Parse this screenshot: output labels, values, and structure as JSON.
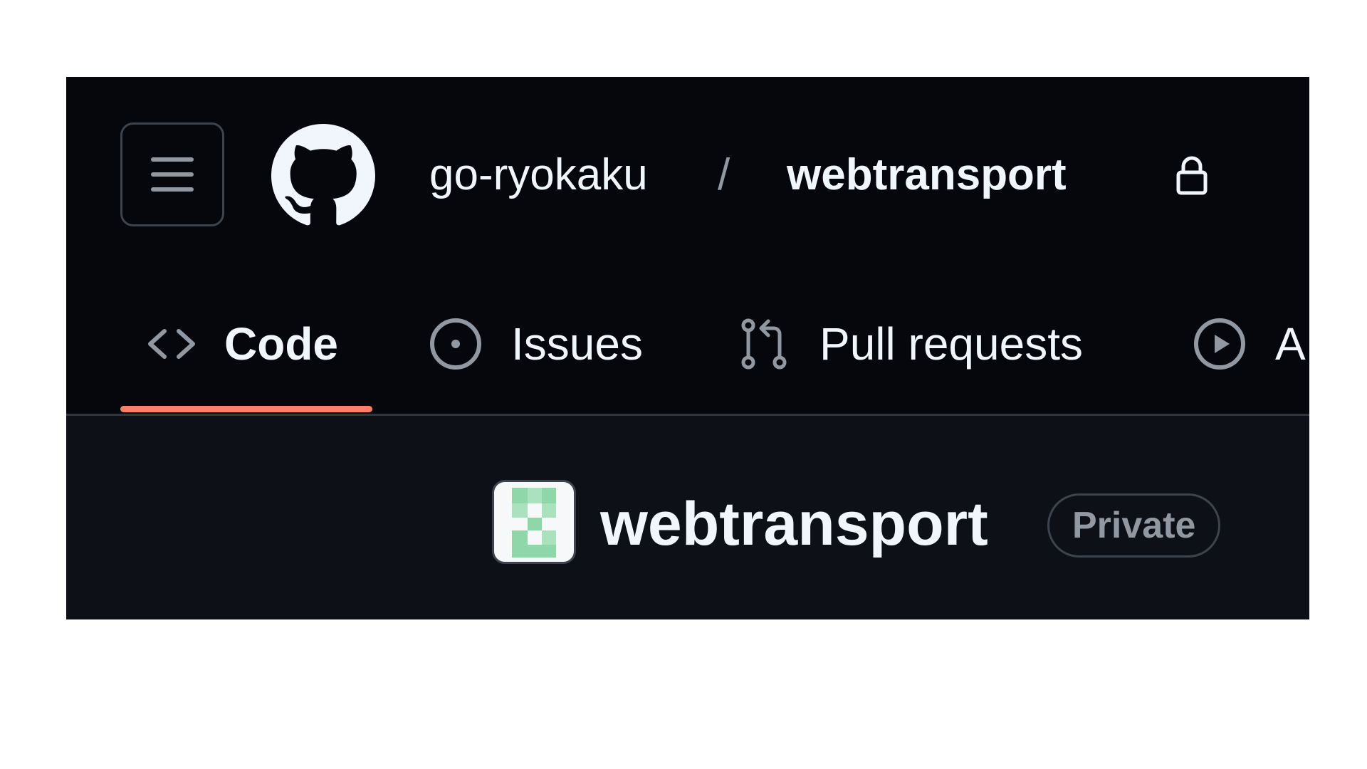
{
  "header": {
    "owner": "go-ryokaku",
    "separator": "/",
    "repo": "webtransport",
    "menu_icon": "hamburger-icon",
    "logo_icon": "github-mark-icon",
    "lock_icon": "lock-icon"
  },
  "tabs": [
    {
      "label": "Code",
      "icon": "code-icon",
      "selected": true
    },
    {
      "label": "Issues",
      "icon": "issue-opened-icon",
      "selected": false
    },
    {
      "label": "Pull requests",
      "icon": "git-pull-request-icon",
      "selected": false
    },
    {
      "label": "A",
      "icon": "play-icon",
      "selected": false
    }
  ],
  "repo_title": {
    "name": "webtransport",
    "visibility": "Private",
    "avatar_icon": "identicon-avatar"
  },
  "colors": {
    "header_bg": "#05070c",
    "content_bg": "#0d1117",
    "text": "#f0f6fc",
    "muted": "#9198a1",
    "border": "#3d444d",
    "tab_underline": "#f78166",
    "identicon": "#8fd7a8"
  }
}
